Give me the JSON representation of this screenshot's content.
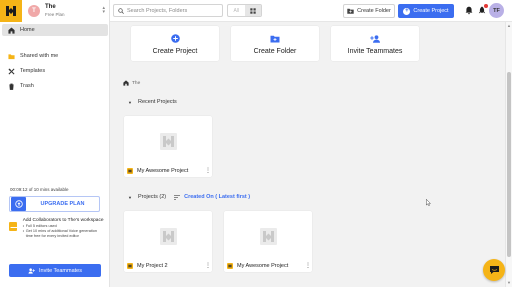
{
  "workspace": {
    "initial": "T",
    "name": "The",
    "plan": "Free Plan"
  },
  "sidebar": {
    "items": [
      {
        "label": "Home",
        "icon": "home-icon",
        "active": true
      },
      {
        "label": "Shared with me",
        "icon": "folder-icon",
        "active": false
      },
      {
        "label": "Templates",
        "icon": "templates-icon",
        "active": false
      },
      {
        "label": "Trash",
        "icon": "trash-icon",
        "active": false
      }
    ],
    "usage_text": "00:09:12 of 10 mins available",
    "upgrade_label": "UPGRADE PLAN",
    "collab": {
      "title": "Add Collaborators to The's workspace",
      "bullets": [
        "Full 5 editors used",
        "Get 10 mins of additional Voice generation time free for every invited editor"
      ]
    },
    "invite_label": "Invite Teammates"
  },
  "header": {
    "search_placeholder": "Search Projects, Folders",
    "view_list_label": "All",
    "create_folder_label": "Create Folder",
    "create_project_label": "Create Project",
    "user_initials": "TF"
  },
  "main": {
    "actions": [
      {
        "label": "Create Project",
        "icon": "plus-circle-icon"
      },
      {
        "label": "Create Folder",
        "icon": "folder-plus-icon"
      },
      {
        "label": "Invite Teammates",
        "icon": "person-add-icon"
      }
    ],
    "breadcrumb": "The",
    "recent_title": "Recent Projects",
    "recent_projects": [
      {
        "name": "My Awesome Project"
      }
    ],
    "projects_title": "Projects (2)",
    "sort_label": "Created On ( Latest first )",
    "projects": [
      {
        "name": "My Project 2"
      },
      {
        "name": "My Awesome Project"
      }
    ]
  },
  "colors": {
    "accent": "#3b6df0",
    "brand": "#f5b417",
    "alert": "#e53935"
  }
}
